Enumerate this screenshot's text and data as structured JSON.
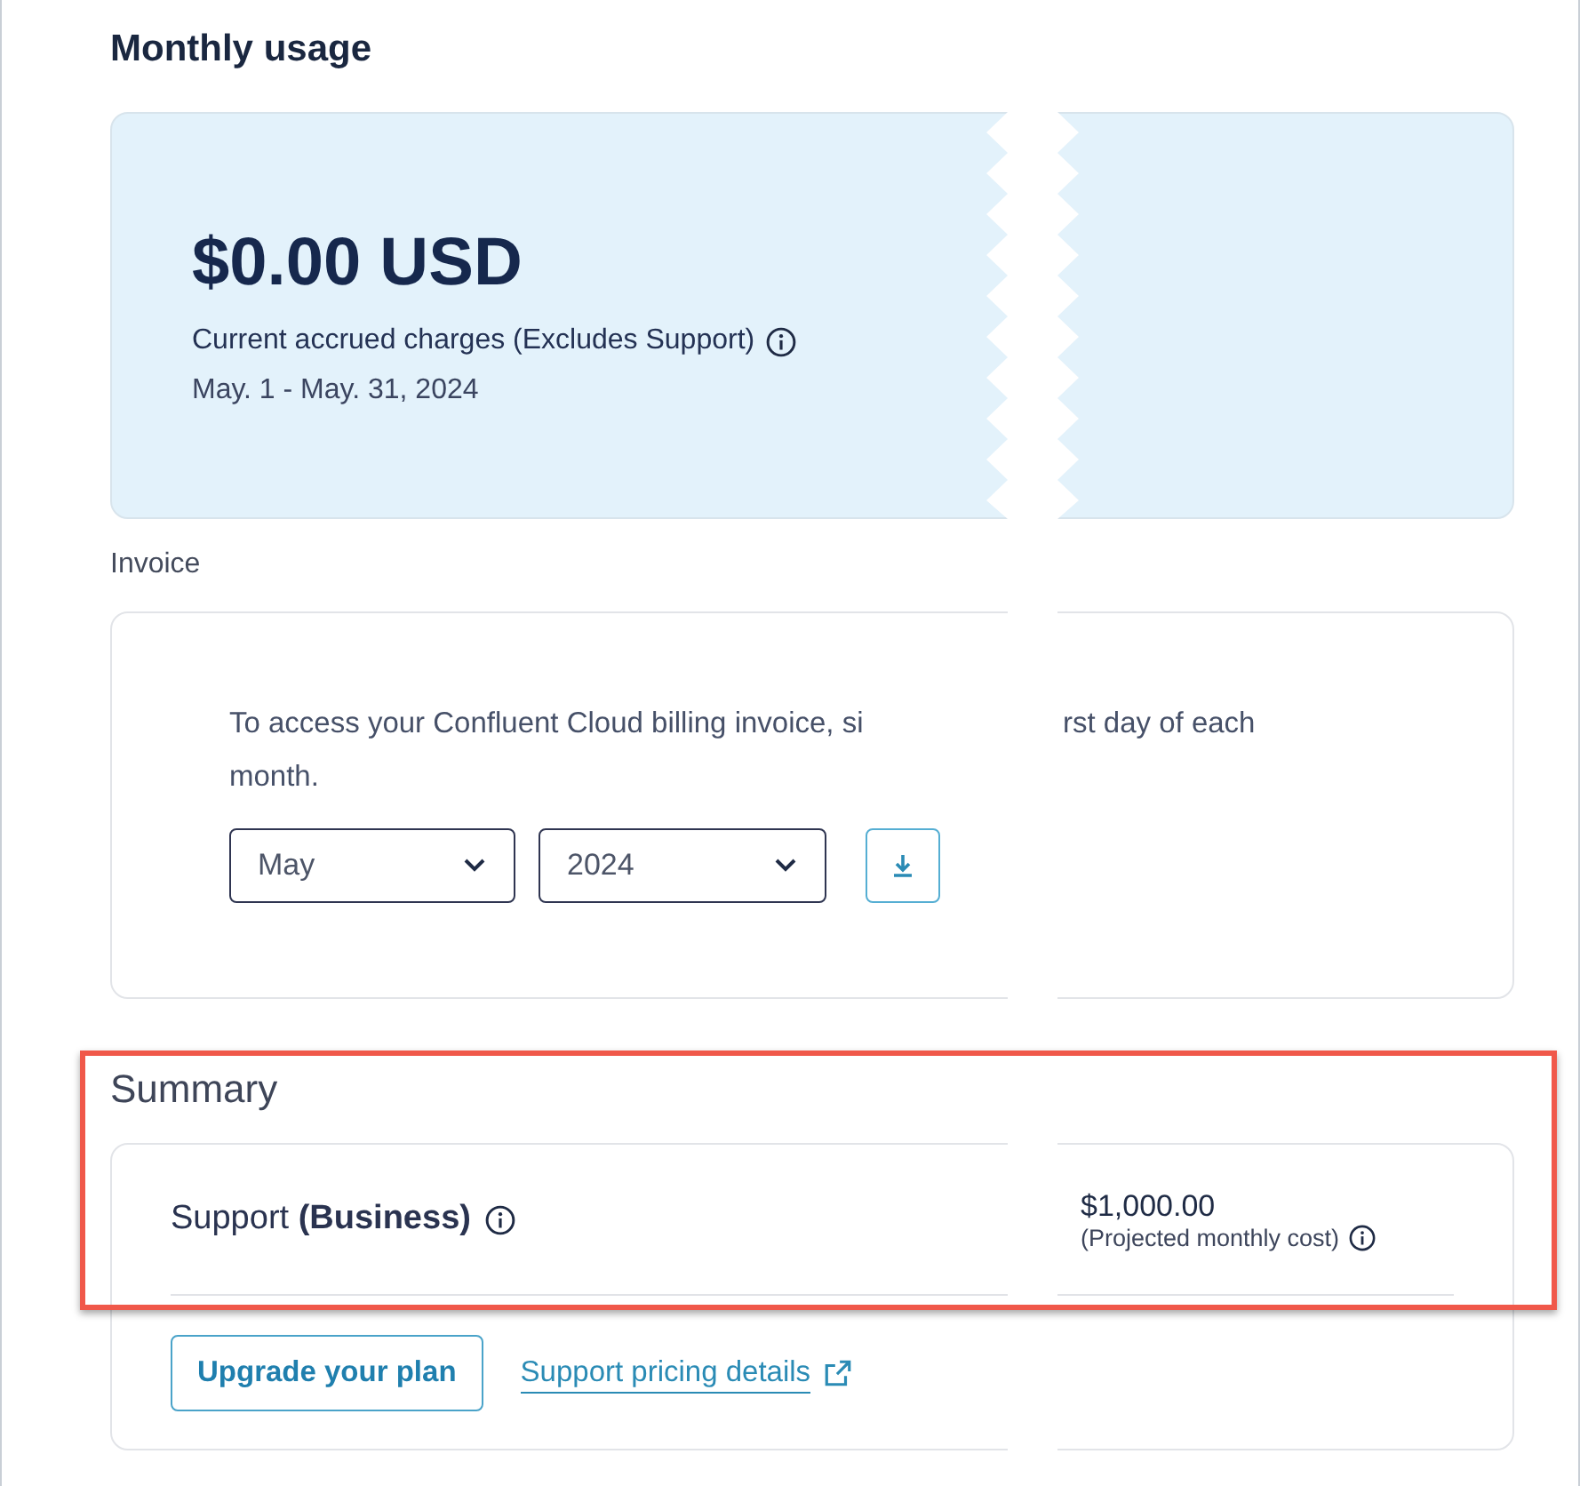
{
  "heading": "Monthly usage",
  "usage_card": {
    "amount": "$0.00 USD",
    "label": "Current accrued charges (Excludes Support)",
    "period": "May. 1 - May. 31, 2024"
  },
  "invoice": {
    "label": "Invoice",
    "text_before_tear": "To access your Confluent Cloud billing invoice, si",
    "text_after_tear": "rst day of each",
    "text_line_2": "month.",
    "month_select": {
      "value": "May"
    },
    "year_select": {
      "value": "2024"
    }
  },
  "summary": {
    "title": "Summary",
    "item": "Support **(Business)**",
    "amount": "$1,000.00",
    "amount_note": "(Projected monthly cost)",
    "upgrade_button": "Upgrade your plan",
    "pricing_link": "Support pricing details"
  }
}
